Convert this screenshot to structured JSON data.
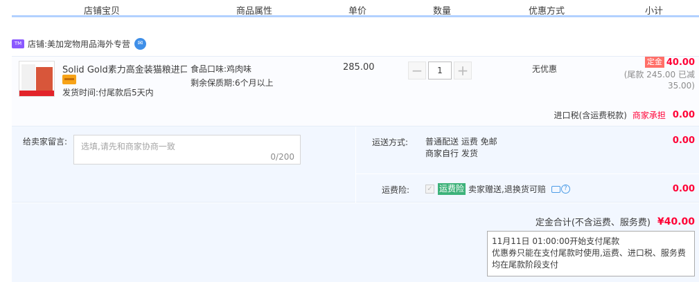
{
  "columns": [
    "店铺宝贝",
    "商品属性",
    "单价",
    "数量",
    "优惠方式",
    "小计"
  ],
  "shop": {
    "prefix": "店铺:",
    "name": "美加宠物用品海外专营"
  },
  "item": {
    "title": "Solid Gold素力高金装猫粮进口...",
    "ship_time": "发货时间:付尾款后5天内",
    "attrs": [
      "食品口味:鸡肉味",
      "剩余保质期:6个月以上"
    ],
    "unit_price": "285.00",
    "qty_minus": "−",
    "qty_value": "1",
    "qty_plus": "+",
    "discount": "无优惠",
    "deposit_tag": "定金",
    "deposit_amount": "40.00",
    "tail_line1": "(尾款 245.00 已减",
    "tail_line2": "35.00)"
  },
  "tax": {
    "label": "进口税(含运费税款)",
    "bearer": "商家承担",
    "value": "0.00"
  },
  "message": {
    "label": "给卖家留言:",
    "placeholder": "选填,请先和商家协商一致",
    "count": "0/200"
  },
  "shipping": {
    "label": "运送方式:",
    "line1": "普通配送 运费 免邮",
    "line2_a": "商家自行",
    "line2_b": "发货",
    "amount": "0.00"
  },
  "insurance": {
    "label": "运费险:",
    "tag": "运费险",
    "text": "卖家赠送,退换货可赔",
    "amount": "0.00"
  },
  "total": {
    "label": "定金合计(不含运费、服务费)",
    "value": "¥40.00",
    "tip_line1": "11月11日 01:00:00开始支付尾款",
    "tip_line2": "优惠券只能在支付尾款时使用,运费、进口税、服务费",
    "tip_line3": "均在尾款阶段支付"
  },
  "colors": {
    "accent_red": "#ff0036",
    "header_rule": "#b2d1ff",
    "panel_bg": "#f2f7ff"
  },
  "icons": [
    "tmall-icon",
    "wangwang-chat-icon",
    "card-pay-icon",
    "checkbox-icon",
    "comment-icon",
    "help-icon"
  ]
}
